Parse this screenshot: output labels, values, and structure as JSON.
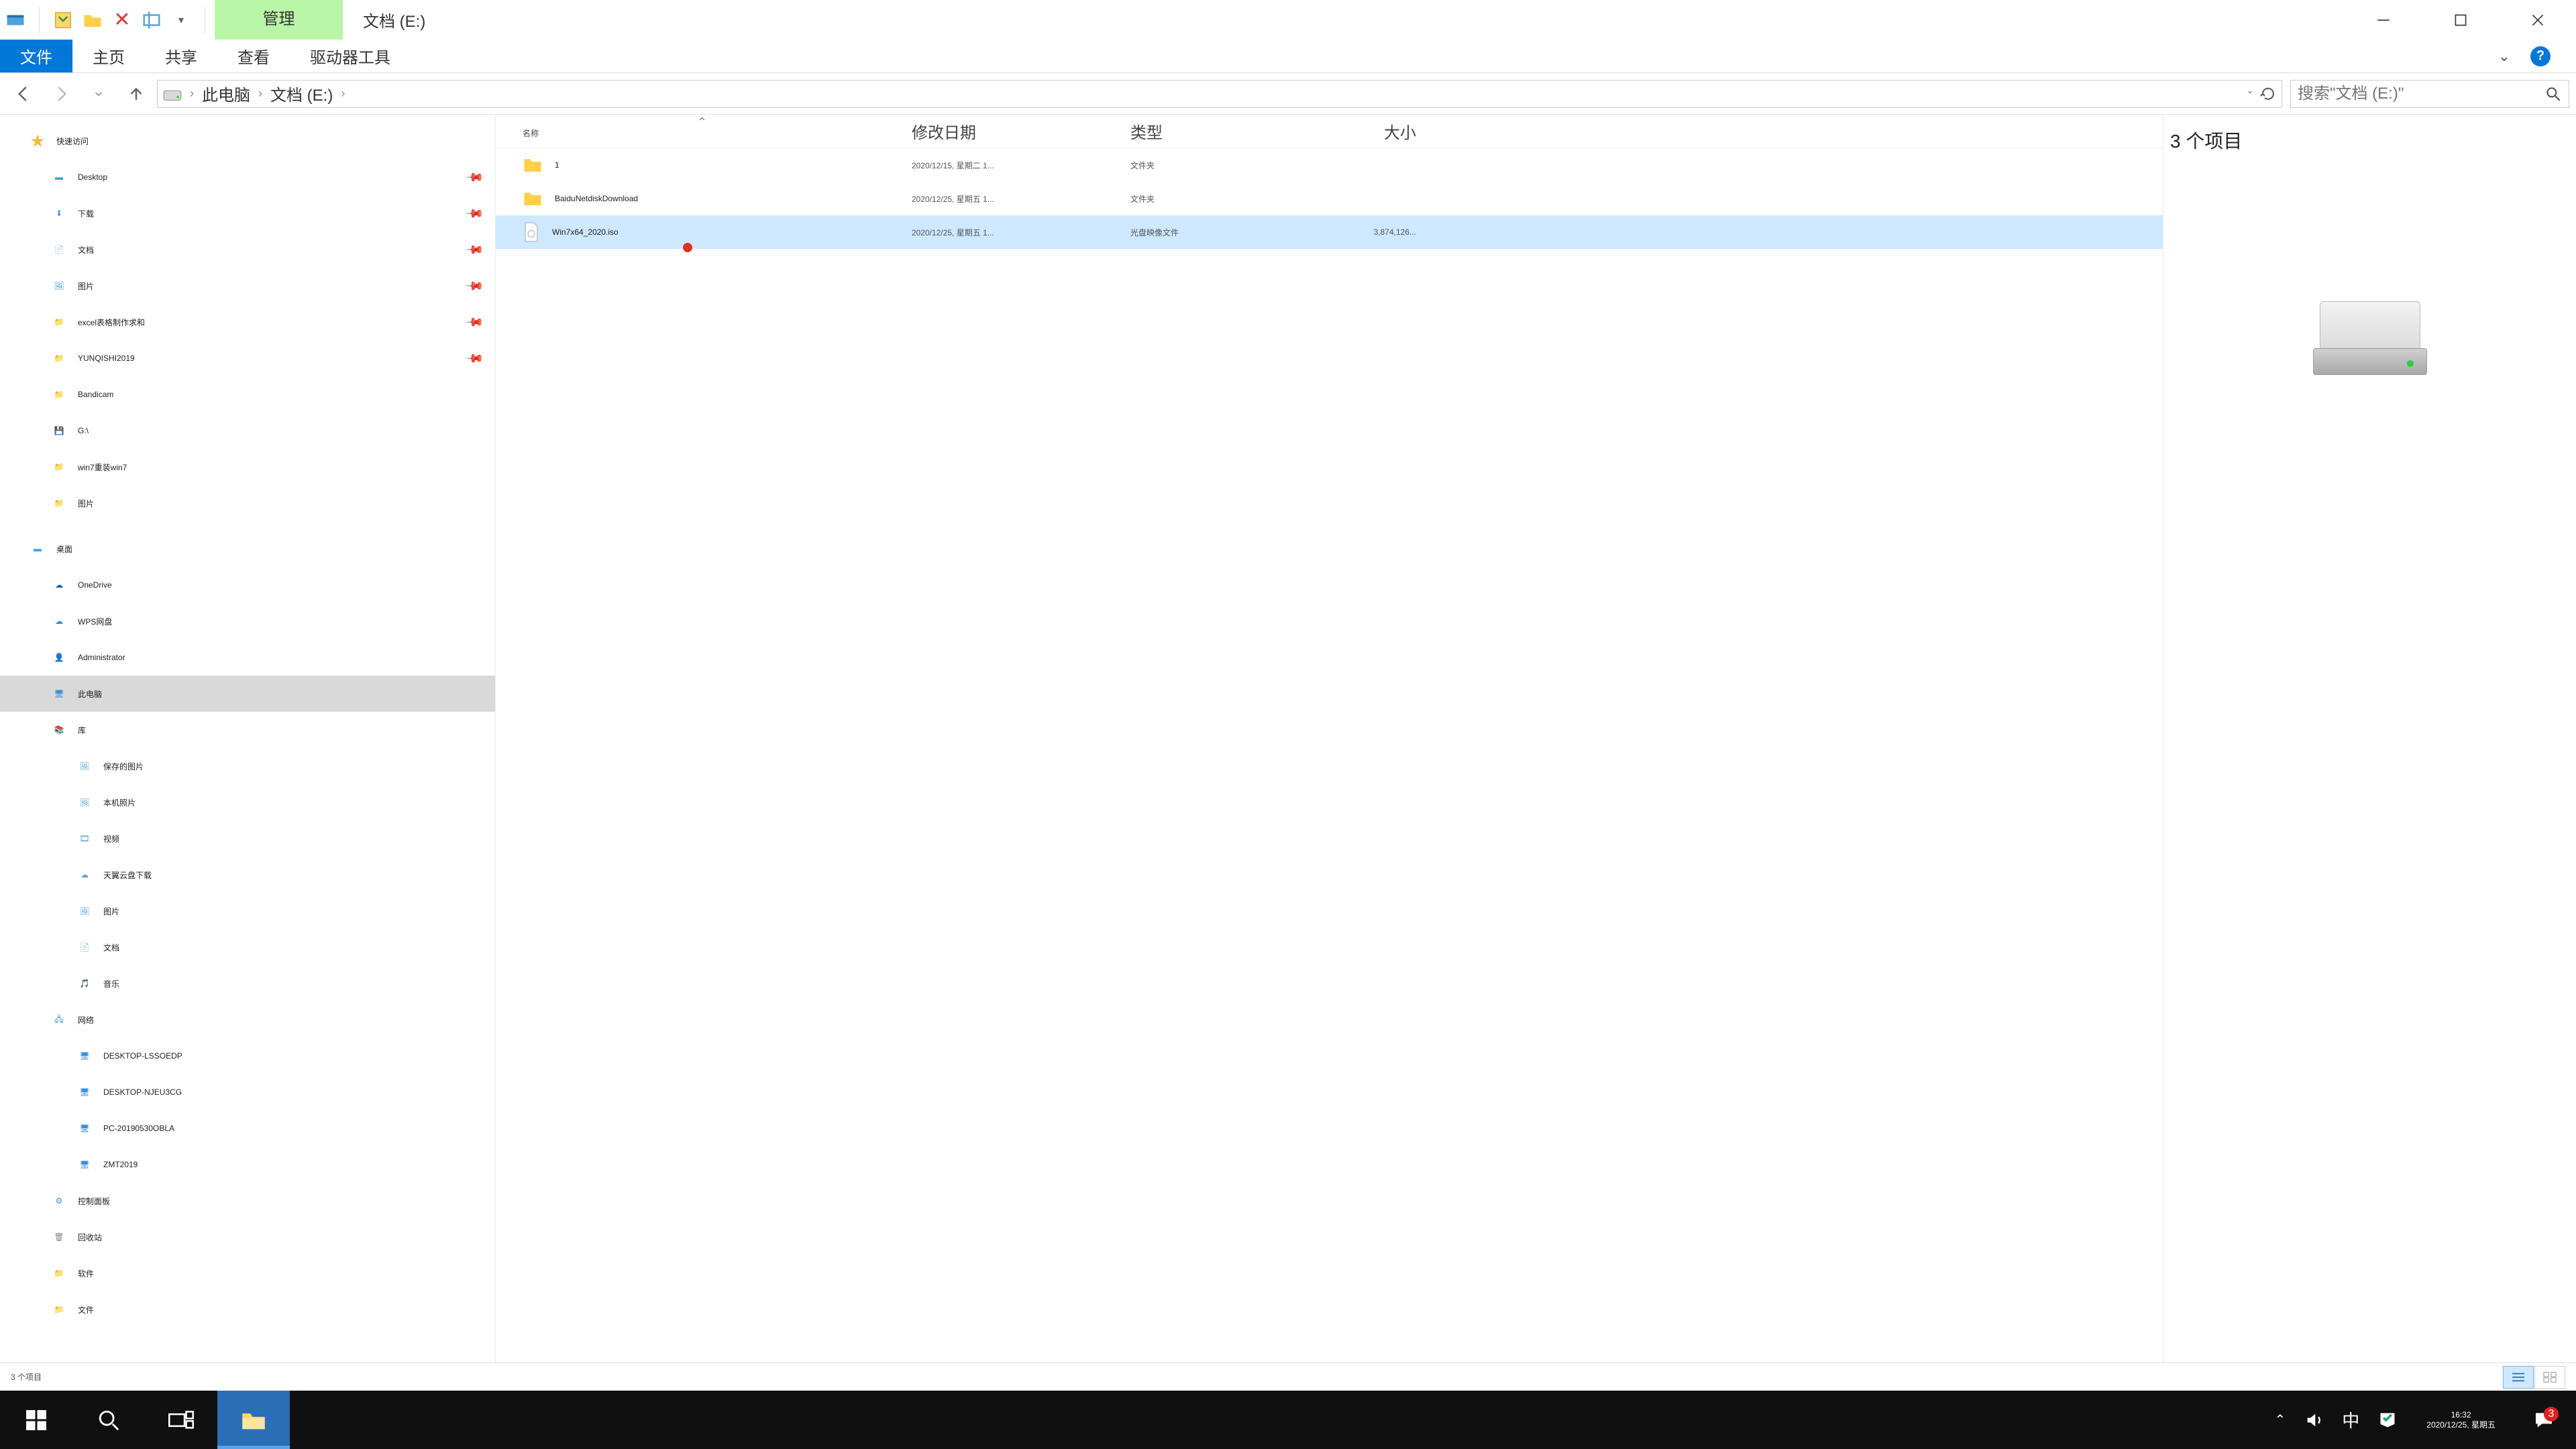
{
  "title_context_tab": "管理",
  "title_location": "文档 (E:)",
  "ribbon": {
    "file": "文件",
    "home": "主页",
    "share": "共享",
    "view": "查看",
    "drive_tools": "驱动器工具"
  },
  "breadcrumb": {
    "seg1": "此电脑",
    "seg2": "文档 (E:)"
  },
  "search": {
    "placeholder": "搜索\"文档 (E:)\""
  },
  "columns": {
    "name": "名称",
    "date": "修改日期",
    "type": "类型",
    "size": "大小"
  },
  "rows": [
    {
      "name": "1",
      "date": "2020/12/15, 星期二 1...",
      "type": "文件夹",
      "size": "",
      "icon": "folder",
      "selected": false
    },
    {
      "name": "BaiduNetdiskDownload",
      "date": "2020/12/25, 星期五 1...",
      "type": "文件夹",
      "size": "",
      "icon": "folder",
      "selected": false
    },
    {
      "name": "Win7x64_2020.iso",
      "date": "2020/12/25, 星期五 1...",
      "type": "光盘映像文件",
      "size": "3,874,126...",
      "icon": "iso",
      "selected": true
    }
  ],
  "tree": {
    "quick_access": "快速访问",
    "desktop": "Desktop",
    "downloads": "下载",
    "documents": "文档",
    "pictures": "图片",
    "excel": "excel表格制作求和",
    "yunqishi": "YUNQISHI2019",
    "bandicam": "Bandicam",
    "gdrive": "G:\\",
    "win7": "win7重装win7",
    "pictures2": "图片",
    "desktop_root": "桌面",
    "onedrive": "OneDrive",
    "wps": "WPS网盘",
    "admin": "Administrator",
    "thispc": "此电脑",
    "libraries": "库",
    "saved_pics": "保存的图片",
    "camera_roll": "本机照片",
    "videos": "视频",
    "tianyi": "天翼云盘下载",
    "pictures3": "图片",
    "docs_lib": "文档",
    "music": "音乐",
    "network": "网络",
    "pc1": "DESKTOP-LSSOEDP",
    "pc2": "DESKTOP-NJEU3CG",
    "pc3": "PC-20190530OBLA",
    "pc4": "ZMT2019",
    "ctrl_panel": "控制面板",
    "recycle": "回收站",
    "software": "软件",
    "files": "文件"
  },
  "preview": {
    "count_label": "3 个项目"
  },
  "statusbar": {
    "count": "3 个项目"
  },
  "systray": {
    "ime": "中",
    "time": "16:32",
    "date": "2020/12/25, 星期五",
    "notif_count": "3"
  }
}
